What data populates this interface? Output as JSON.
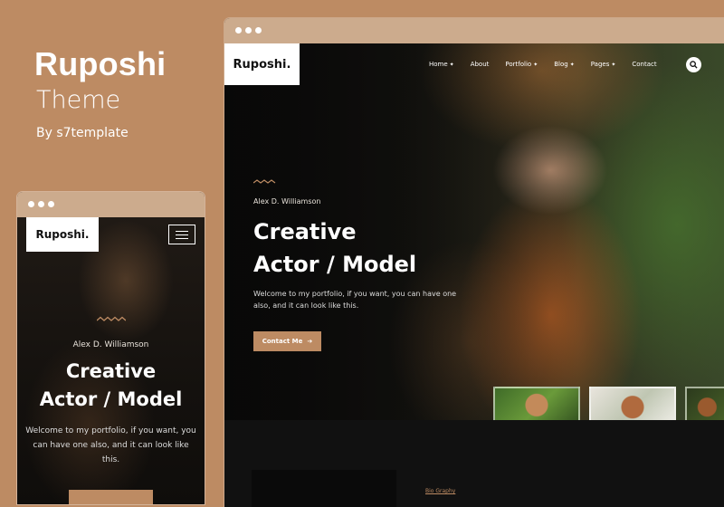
{
  "promo": {
    "title": "Ruposhi",
    "subtitle": "Theme",
    "byline": "By s7template"
  },
  "desktop": {
    "logo": "Ruposhi.",
    "nav": [
      {
        "label": "Home",
        "has_caret": true
      },
      {
        "label": "About",
        "has_caret": false
      },
      {
        "label": "Portfolio",
        "has_caret": true
      },
      {
        "label": "Blog",
        "has_caret": true
      },
      {
        "label": "Pages",
        "has_caret": true
      },
      {
        "label": "Contact",
        "has_caret": false
      }
    ],
    "caret": "✦",
    "hero": {
      "author": "Alex D. Williamson",
      "heading_line1": "Creative",
      "heading_line2": "Actor / Model",
      "intro": "Welcome to my portfolio, if you want, you can have one also, and it can look like this.",
      "cta_label": "Contact Me",
      "cta_arrow": "➔"
    },
    "bio_link": "Bio Graphy"
  },
  "mobile": {
    "logo": "Ruposhi.",
    "author": "Alex D. Williamson",
    "heading_line1": "Creative",
    "heading_line2": "Actor / Model",
    "intro": "Welcome to my portfolio, if you want, you can have one also, and it can look like this."
  },
  "colors": {
    "background": "#bd8b63",
    "window_bar": "#ccab8d",
    "accent": "#bd8b63",
    "hero_dark": "#111111"
  },
  "icons": {
    "search": "search-icon",
    "menu": "hamburger-menu-icon",
    "wave": "wave-divider-icon",
    "arrow": "arrow-right-icon"
  }
}
